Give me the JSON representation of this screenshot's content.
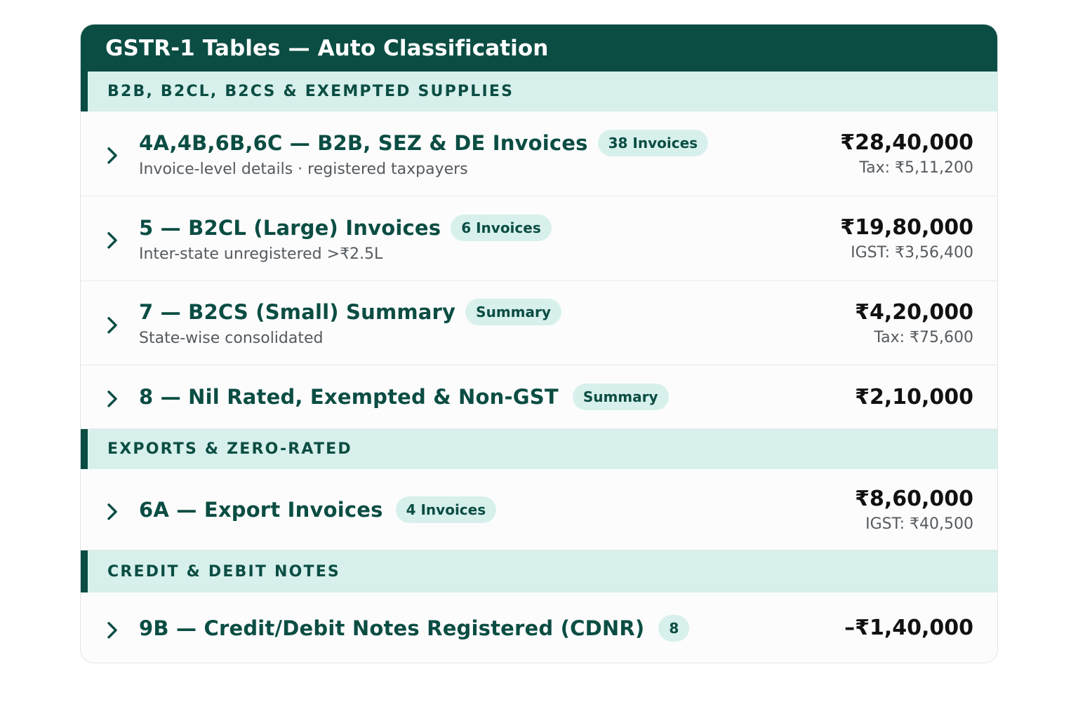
{
  "panel": {
    "title": "GSTR-1 Tables — Auto Classification"
  },
  "sections": [
    {
      "heading": "B2B, B2CL, B2CS & EXEMPTED SUPPLIES",
      "rows": [
        {
          "title": "4A,4B,6B,6C — B2B, SEZ & DE Invoices",
          "badge": "38 Invoices",
          "subtitle": "Invoice-level details · registered taxpayers",
          "amount": "₹28,40,000",
          "tax": "Tax: ₹5,11,200"
        },
        {
          "title": "5 — B2CL (Large) Invoices",
          "badge": "6 Invoices",
          "subtitle": "Inter-state unregistered >₹2.5L",
          "amount": "₹19,80,000",
          "tax": "IGST: ₹3,56,400"
        },
        {
          "title": "7 — B2CS (Small) Summary",
          "badge": "Summary",
          "subtitle": "State-wise consolidated",
          "amount": "₹4,20,000",
          "tax": "Tax: ₹75,600"
        },
        {
          "title": "8 — Nil Rated, Exempted & Non-GST",
          "badge": "Summary",
          "amount": "₹2,10,000"
        }
      ]
    },
    {
      "heading": "EXPORTS & ZERO-RATED",
      "rows": [
        {
          "title": "6A — Export Invoices",
          "badge": "4 Invoices",
          "amount": "₹8,60,000",
          "tax": "IGST: ₹40,500"
        }
      ]
    },
    {
      "heading": "CREDIT & DEBIT NOTES",
      "rows": [
        {
          "title": "9B — Credit/Debit Notes Registered (CDNR)",
          "badge": "8",
          "amount": "–₹1,40,000"
        }
      ]
    }
  ],
  "icons": {
    "row_expand": "chevron-right-icon"
  },
  "colors": {
    "primary": "#0b4d43",
    "accent_bg": "#d7f0ec",
    "muted_text": "#555a5e",
    "amount_text": "#111111"
  }
}
